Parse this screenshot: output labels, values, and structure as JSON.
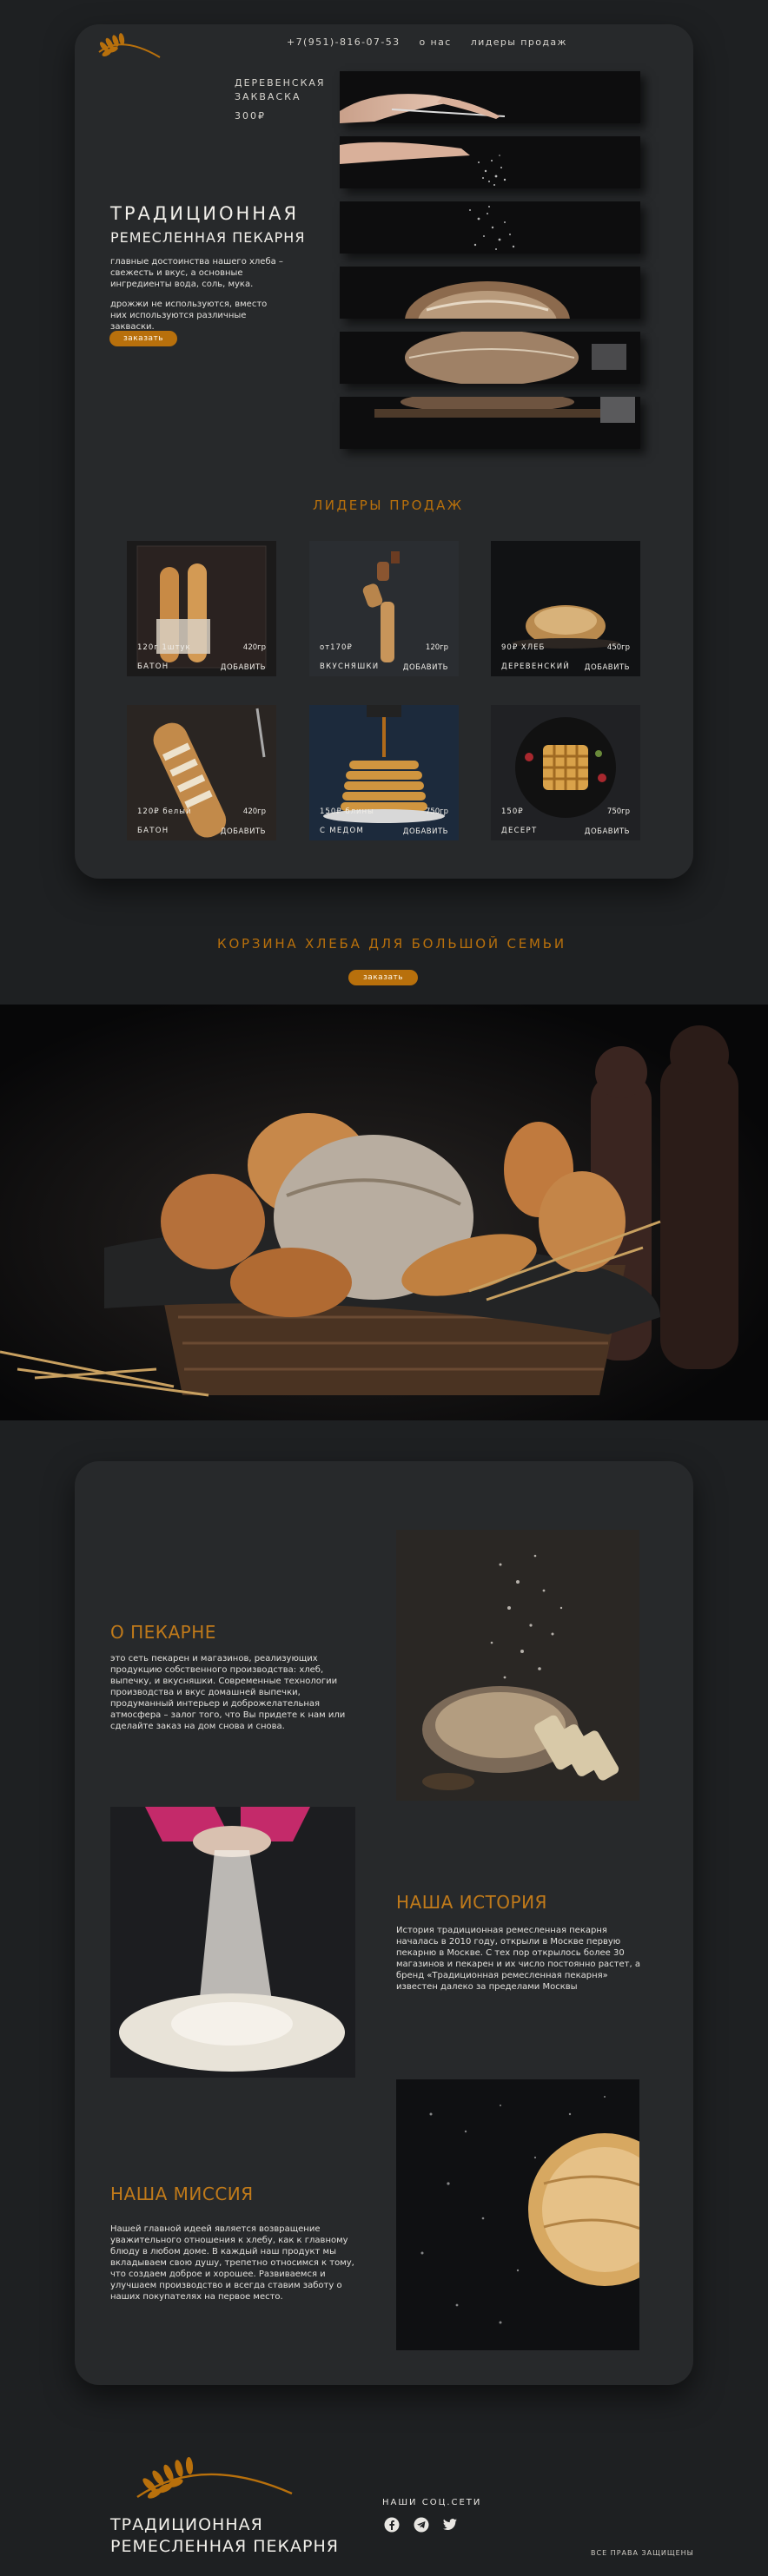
{
  "colors": {
    "background": "#1e2022",
    "card": "#27292b",
    "accent": "#b8700c",
    "text": "#f1efea"
  },
  "header": {
    "phone": "+7(951)-816-07-53",
    "nav_about": "о нас",
    "nav_leaders": "лидеры продаж",
    "logo_icon": "wheat-ear-icon"
  },
  "hero": {
    "product_name": "ДЕРЕВЕНСКАЯ ЗАКВАСКА",
    "product_price": "300₽",
    "title": "ТРАДИЦИОННАЯ",
    "subtitle": "РЕМЕСЛЕННАЯ ПЕКАРНЯ",
    "desc1": "главные достоинства нашего хлеба – свежесть и вкус, а основные ингредиенты вода, соль, мука.",
    "desc2": "дрожжи не используются, вместо них используются различные закваски.",
    "order_button": "заказать"
  },
  "leaders": {
    "title": "ЛИДЕРЫ ПРОДАЖ",
    "add_label": "ДОБАВИТЬ",
    "items": [
      {
        "weight": "120г\n1штук",
        "name": "БАТОН",
        "price": "420гр"
      },
      {
        "weight": "от170₽",
        "name": "ВКУСНЯШКИ",
        "price": "120гр"
      },
      {
        "weight": "90₽\nХЛЕБ",
        "name": "ДЕРЕВЕНСКИЙ",
        "price": "450гр"
      },
      {
        "weight": "120₽\nбелый",
        "name": "БАТОН",
        "price": "420гр"
      },
      {
        "weight": "150₽\nблины",
        "name": "С МЕДОМ",
        "price": "750гр"
      },
      {
        "weight": "150₽",
        "name": "ДЕСЕРТ",
        "price": "750гр"
      }
    ]
  },
  "basket": {
    "title": "КОРЗИНА ХЛЕБА ДЛЯ БОЛЬШОЙ СЕМЬИ",
    "order_button": "заказать"
  },
  "about": {
    "bakery_title": "О ПЕКАРНЕ",
    "bakery_text": "это сеть пекарен и магазинов, реализующих продукцию собственного производства: хлеб, выпечку, и вкусняшки. Современные технологии производства и вкус домашней выпечки, продуманный интерьер и доброжелательная атмосфера – залог того, что Вы придете к нам или сделайте заказ на дом снова и снова.",
    "history_title": "НАША ИСТОРИЯ",
    "history_text": "История традиционная ремесленная пекарня началась в 2010 году, открыли в Москве первую пекарню в Москве. С тех пор открылось более 30 магазинов и пекарен и их число постоянно растет, а бренд «Традиционная ремесленная пекарня» известен далеко за пределами Москвы",
    "mission_title": "НАША МИССИЯ",
    "mission_text": "Нашей главной идеей является возвращение уважительного отношения к хлебу, как к главному блюду в любом доме. В каждый наш продукт мы вкладываем свою душу, трепетно относимся к тому, что создаем доброе и хорошее. Развиваемся и улучшаем производство и всегда ставим заботу о наших покупателях на первое место."
  },
  "footer": {
    "title1": "ТРАДИЦИОННАЯ",
    "title2": "РЕМЕСЛЕННАЯ ПЕКАРНЯ",
    "social_title": "НАШИ СОЦ.СЕТИ",
    "social_icons": [
      "facebook-icon",
      "telegram-icon",
      "twitter-icon"
    ],
    "rights": "ВСЕ ПРАВА ЗАЩИЩЕНЫ"
  }
}
